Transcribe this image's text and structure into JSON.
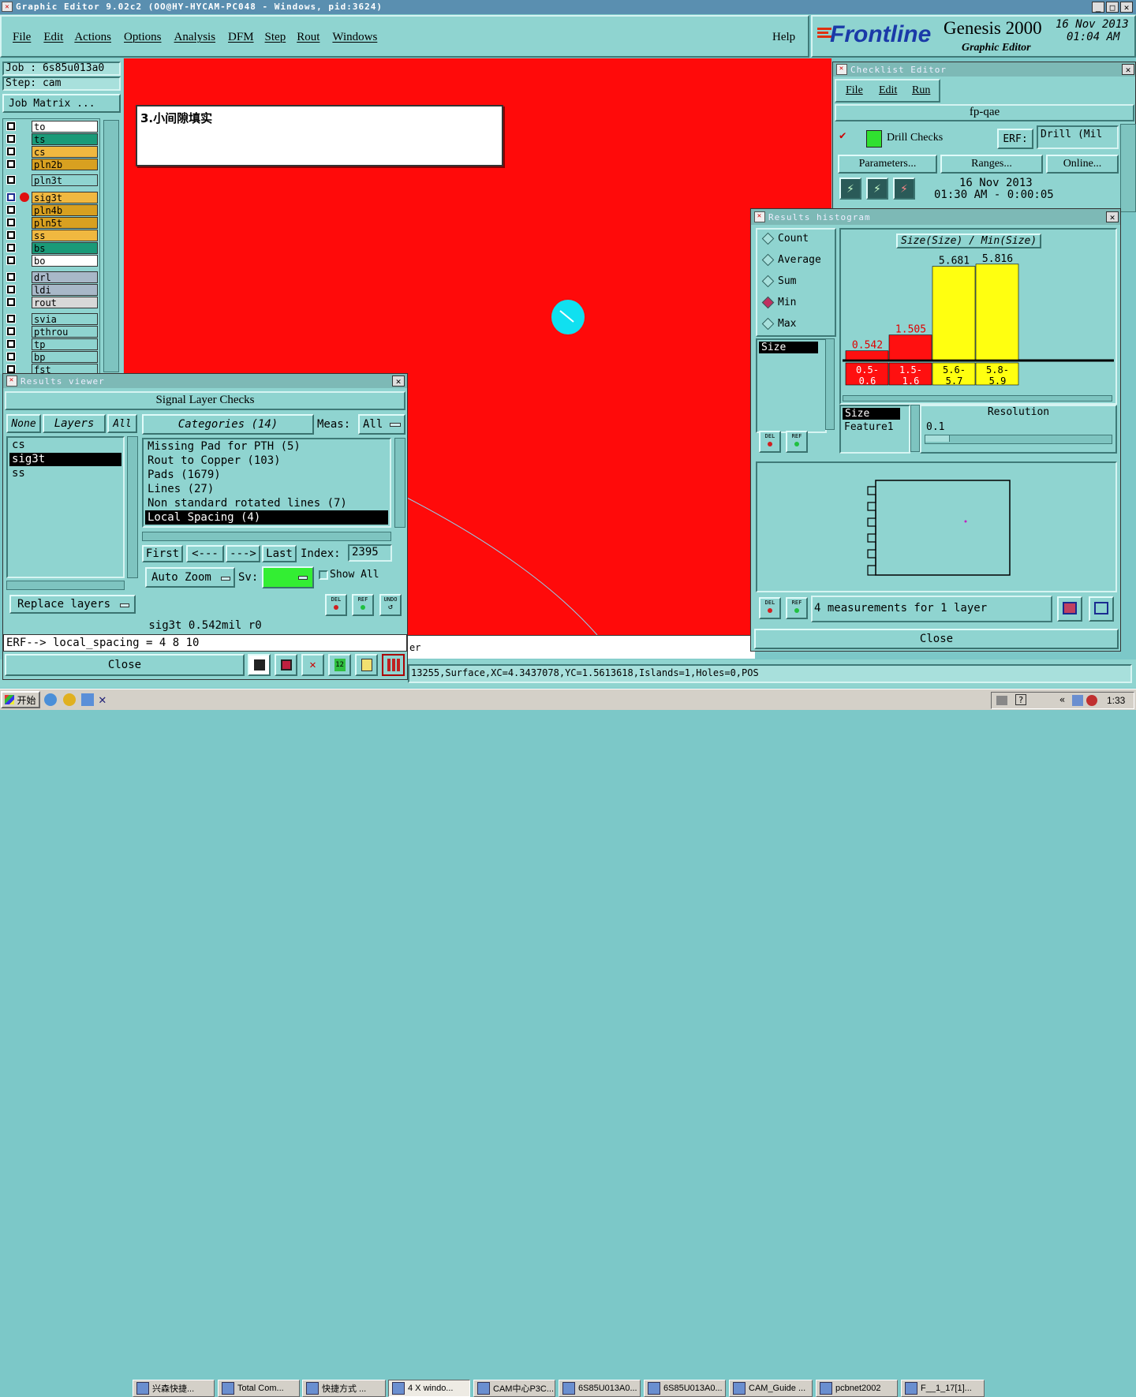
{
  "titlebar": {
    "text": "Graphic Editor 9.02c2 (OO@HY-HYCAM-PC048 - Windows, pid:3624)"
  },
  "menu": [
    "File",
    "Edit",
    "Actions",
    "Options",
    "Analysis",
    "DFM",
    "Step",
    "Rout",
    "Windows"
  ],
  "help": "Help",
  "brand": {
    "logo": "Frontline",
    "product": "Genesis 2000",
    "subtitle": "Graphic Editor",
    "date": "16 Nov 2013",
    "time": "01:04 AM"
  },
  "job": {
    "job_line": "Job  :  6s85u013a0",
    "step_line": "Step:  cam",
    "matrix_button": "Job Matrix ..."
  },
  "layers": [
    {
      "name": "to",
      "color": "#ffffff"
    },
    {
      "name": "ts",
      "color": "#1a9a78"
    },
    {
      "name": "cs",
      "color": "#f0b840"
    },
    {
      "name": "pln2b",
      "color": "#d8a020"
    },
    {
      "name": "pln3t",
      "color": "#8fd4d0"
    },
    {
      "name": "sig3t",
      "color": "#f0b840"
    },
    {
      "name": "pln4b",
      "color": "#d8a020"
    },
    {
      "name": "pln5t",
      "color": "#d8a020"
    },
    {
      "name": "ss",
      "color": "#f0b840"
    },
    {
      "name": "bs",
      "color": "#1a9a78"
    },
    {
      "name": "bo",
      "color": "#ffffff"
    },
    {
      "name": "drl",
      "color": "#a8b8c8"
    },
    {
      "name": "ldi",
      "color": "#a8b8c8"
    },
    {
      "name": "rout",
      "color": "#d8d8d8"
    },
    {
      "name": "svia",
      "color": "#8fd4d0"
    },
    {
      "name": "pthrou",
      "color": "#8fd4d0"
    },
    {
      "name": "tp",
      "color": "#8fd4d0"
    },
    {
      "name": "bp",
      "color": "#8fd4d0"
    },
    {
      "name": "fst",
      "color": "#8fd4d0"
    }
  ],
  "canvas": {
    "note": "3.小间隙填实",
    "status_partial": "er"
  },
  "status_bar": "13255,Surface,XC=4.3437078,YC=1.5613618,Islands=1,Holes=0,POS",
  "results_viewer": {
    "title": "Results viewer",
    "header": "Signal Layer Checks",
    "none_btn": "None",
    "layers_label": "Layers",
    "all_btn": "All",
    "categories_label": "Categories (14)",
    "meas_label": "Meas:",
    "meas_value": "All",
    "layer_list": [
      "cs",
      "sig3t",
      "ss"
    ],
    "categories": [
      "Missing Pad for PTH (5)",
      "Rout to Copper (103)",
      "Pads (1679)",
      "Lines (27)",
      "Non standard rotated lines (7)",
      "Local Spacing (4)"
    ],
    "nav": {
      "first": "First",
      "prev": "<---",
      "next": "--->",
      "last": "Last",
      "index_label": "Index:",
      "index_value": "2395"
    },
    "auto_zoom": "Auto Zoom",
    "sv_label": "Sv:",
    "show_all": "Show All",
    "replace_layers": "Replace layers",
    "del": "DEL",
    "ref": "REF",
    "undo": "UNDO",
    "info_line": "sig3t 0.542mil  r0",
    "erf_line": "ERF--> local_spacing = 4 8 10",
    "close": "Close"
  },
  "checklist": {
    "title": "Checklist Editor",
    "menu": [
      "File",
      "Edit",
      "Run"
    ],
    "name": "fp-qae",
    "check_name": "Drill Checks",
    "erf_label": "ERF:",
    "erf_value": "Drill (Mil",
    "buttons": [
      "Parameters...",
      "Ranges...",
      "Online..."
    ],
    "date": "16 Nov 2013",
    "time_line": "01:30 AM - 0:00:05"
  },
  "histogram": {
    "title": "Results histogram",
    "options": [
      "Count",
      "Average",
      "Sum",
      "Min",
      "Max"
    ],
    "selected_option": "Min",
    "list_item": "Size",
    "chart_title": "Size(Size) / Min(Size)",
    "size_header": "Size",
    "feature_label": "Feature1",
    "resolution_label": "Resolution",
    "resolution_value": "0.1",
    "measure_text": "4 measurements for 1 layer",
    "del": "DEL",
    "ref": "REF",
    "close": "Close"
  },
  "chart_data": {
    "type": "bar",
    "title": "Size(Size) / Min(Size)",
    "categories": [
      "0.5-0.6",
      "1.5-1.6",
      "5.6-5.7",
      "5.8-5.9"
    ],
    "values": [
      0.542,
      1.505,
      5.681,
      5.816
    ],
    "labels": [
      "0.542",
      "1.505",
      "5.681",
      "5.816"
    ],
    "bar_colors": [
      "#ff1010",
      "#ff1010",
      "#ffff10",
      "#ffff10"
    ],
    "ylim": [
      0,
      6
    ]
  },
  "taskbar": {
    "start": "开始",
    "items": [
      "兴森快捷...",
      "Total Com...",
      "快捷方式 ...",
      "4 X windo...",
      "CAM中心P3C...",
      "6S85U013A0...",
      "6S85U013A0...",
      "CAM_Guide ...",
      "pcbnet2002",
      "F__1_17[1]..."
    ],
    "clock": "1:33"
  },
  "colors": {
    "canvas_red": "#ff0a0a",
    "panel_teal": "#8fd4d0",
    "highlight_green": "#33ee33"
  }
}
